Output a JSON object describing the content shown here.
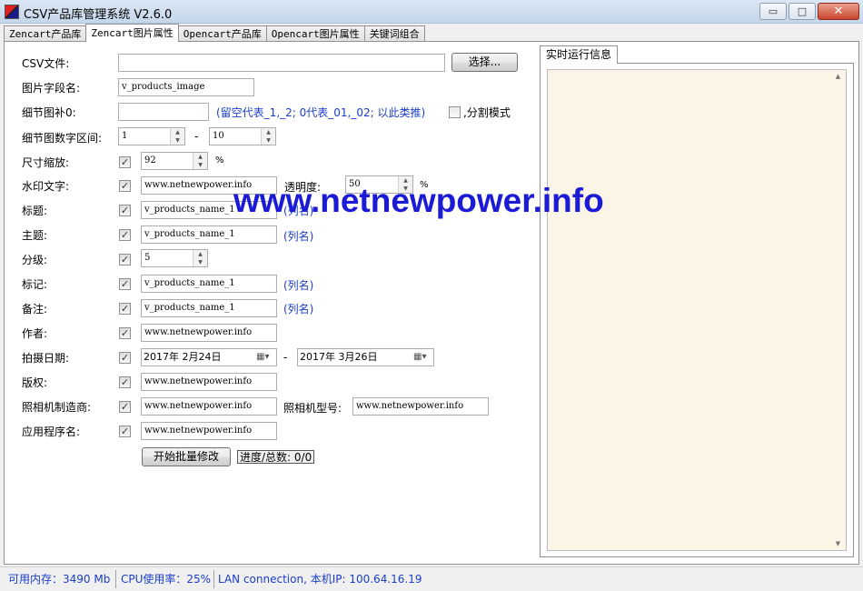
{
  "window": {
    "title": "CSV产品库管理系统 V2.6.0",
    "minimize": "▭",
    "maximize": "□",
    "close": "✕"
  },
  "tabs": [
    "Zencart产品库",
    "Zencart图片属性",
    "Opencart产品库",
    "Opencart图片属性",
    "关键词组合"
  ],
  "active_tab": 1,
  "form": {
    "csv_file": {
      "label": "CSV文件:",
      "value": "",
      "button": "选择..."
    },
    "image_field": {
      "label": "图片字段名:",
      "value": "v_products_image"
    },
    "detail_suffix": {
      "label": "细节图补0:",
      "value": "",
      "hint": "(留空代表_1,_2; 0代表_01,_02; 以此类推)",
      "split_label": ",分割模式",
      "split_checked": false
    },
    "detail_range": {
      "label": "细节图数字区间:",
      "from": "1",
      "dash": "-",
      "to": "10"
    },
    "scale": {
      "label": "尺寸缩放:",
      "checked": true,
      "value": "92",
      "unit": "%"
    },
    "watermark_text": {
      "label": "水印文字:",
      "checked": true,
      "value": "www.netnewpower.info",
      "opacity_label": "透明度:",
      "opacity": "50",
      "opacity_unit": "%"
    },
    "title": {
      "label": "标题:",
      "checked": true,
      "value": "v_products_name_1",
      "hint": "(列名)"
    },
    "subject": {
      "label": "主题:",
      "checked": true,
      "value": "v_products_name_1",
      "hint": "(列名)"
    },
    "rating": {
      "label": "分级:",
      "checked": true,
      "value": "5"
    },
    "tags": {
      "label": "标记:",
      "checked": true,
      "value": "v_products_name_1",
      "hint": "(列名)"
    },
    "comments": {
      "label": "备注:",
      "checked": true,
      "value": "v_products_name_1",
      "hint": "(列名)"
    },
    "author": {
      "label": "作者:",
      "checked": true,
      "value": "www.netnewpower.info"
    },
    "date_taken": {
      "label": "拍摄日期:",
      "checked": true,
      "from": "2017年  2月24日",
      "dash": "-",
      "to": "2017年  3月26日"
    },
    "copyright": {
      "label": "版权:",
      "checked": true,
      "value": "www.netnewpower.info"
    },
    "camera_maker": {
      "label": "照相机制造商:",
      "checked": true,
      "value": "www.netnewpower.info",
      "model_label": "照相机型号:",
      "model_value": "www.netnewpower.info"
    },
    "program_name": {
      "label": "应用程序名:",
      "checked": true,
      "value": "www.netnewpower.info"
    },
    "start_button": "开始批量修改",
    "progress": "进度/总数: 0/0"
  },
  "watermark_overlay": "www.netnewpower.info",
  "log_panel": {
    "tab": "实时运行信息",
    "content": ""
  },
  "status": {
    "memory": "可用内存：3490 Mb",
    "cpu": "CPU使用率：25%",
    "network": "LAN connection,  本机IP: 100.64.16.19"
  },
  "colors": {
    "accent_text": "#1a3ec8",
    "watermark": "#1b1bd6",
    "log_bg": "#fbf5e7"
  }
}
